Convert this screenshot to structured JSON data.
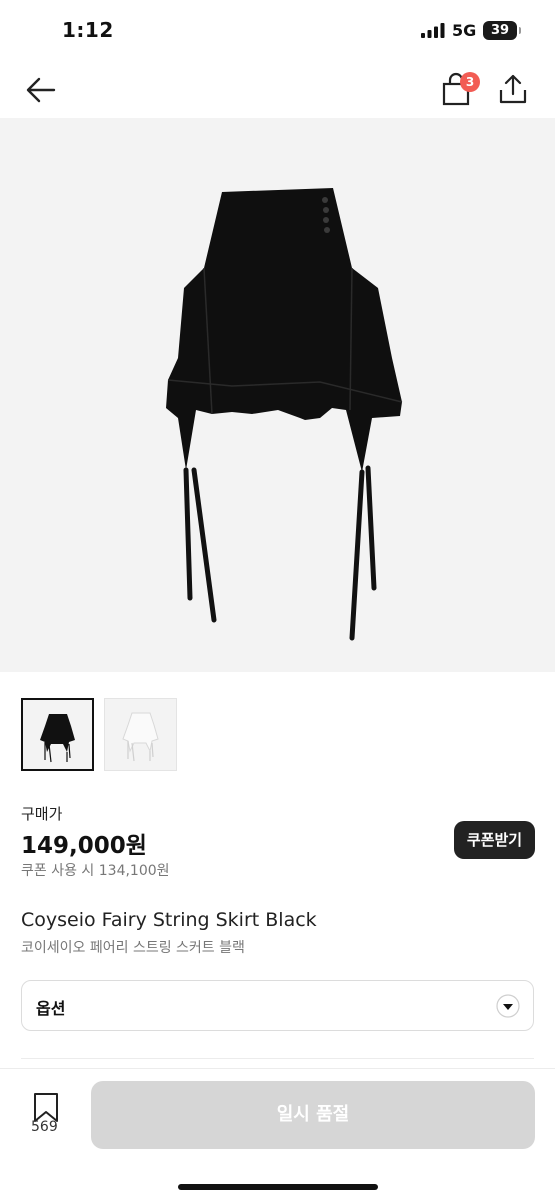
{
  "status_bar": {
    "time": "1:12",
    "network": "5G",
    "battery": "39"
  },
  "nav": {
    "cart_count": "3"
  },
  "product": {
    "price_label": "구매가",
    "price": "149,000원",
    "coupon_price": "쿠폰 사용 시 134,100원",
    "coupon_button": "쿠폰받기",
    "name_en": "Coyseio Fairy String Skirt Black",
    "name_ko": "코이세이오 페어리 스트링 스커트 블랙",
    "option_label": "옵션"
  },
  "bottom_bar": {
    "wish_count": "569",
    "action_label": "일시 품절"
  },
  "colors": {
    "badge": "#f25c54",
    "button_dark": "#222222",
    "disabled": "#d6d6d6"
  }
}
